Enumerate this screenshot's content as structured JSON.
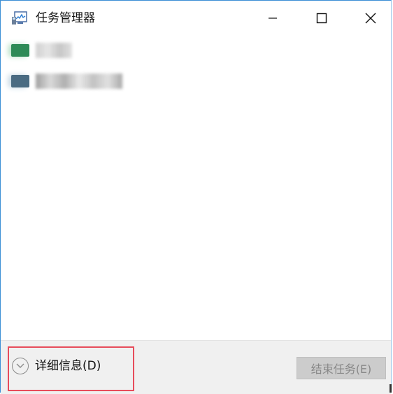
{
  "window": {
    "title": "任务管理器",
    "icon": "task-manager-icon",
    "controls": {
      "minimize_icon": "minimize-icon",
      "maximize_icon": "maximize-icon",
      "close_icon": "close-icon"
    }
  },
  "processes": [
    {
      "icon_color": "#2e8b57"
    },
    {
      "icon_color": "#4a6b82"
    }
  ],
  "footer": {
    "details_label": "详细信息(D)",
    "details_icon": "chevron-down-icon",
    "end_task_label": "结束任务(E)",
    "end_task_enabled": false,
    "highlight_color": "#e74c5b"
  }
}
